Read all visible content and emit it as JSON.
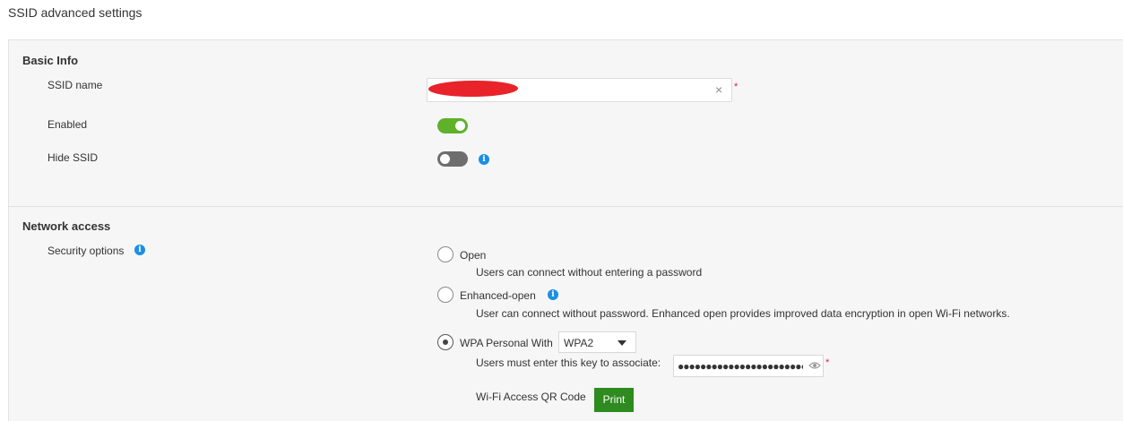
{
  "page": {
    "title": "SSID advanced settings"
  },
  "basic_info": {
    "title": "Basic Info",
    "ssid_name": {
      "label": "SSID name",
      "value": "",
      "required_mark": "*",
      "clear_icon": "×"
    },
    "enabled": {
      "label": "Enabled",
      "state": true
    },
    "hide_ssid": {
      "label": "Hide SSID",
      "state": false,
      "info_icon": "i"
    }
  },
  "network_access": {
    "title": "Network access",
    "security_options": {
      "label": "Security options",
      "info_icon": "i",
      "options": [
        {
          "label": "Open",
          "description": "Users can connect without entering a password",
          "selected": false
        },
        {
          "label": "Enhanced-open",
          "description": "User can connect without password. Enhanced open provides improved data encryption in open Wi-Fi networks.",
          "selected": false,
          "info_icon": "i"
        },
        {
          "label": "WPA Personal With",
          "selected": true,
          "wpa_select": {
            "value": "WPA2"
          }
        }
      ]
    },
    "key": {
      "label": "Users must enter this key to associate:",
      "masked_value": "●●●●●●●●●●●●●●●●●●●●●●●",
      "required_mark": "*"
    },
    "qr": {
      "label": "Wi-Fi Access QR Code",
      "print_label": "Print"
    }
  },
  "colors": {
    "toggle_on": "#5fb12a",
    "toggle_off": "#6e6e6e",
    "info": "#1a8fe3",
    "print_button": "#2e8b1f",
    "required": "#e8232a"
  }
}
